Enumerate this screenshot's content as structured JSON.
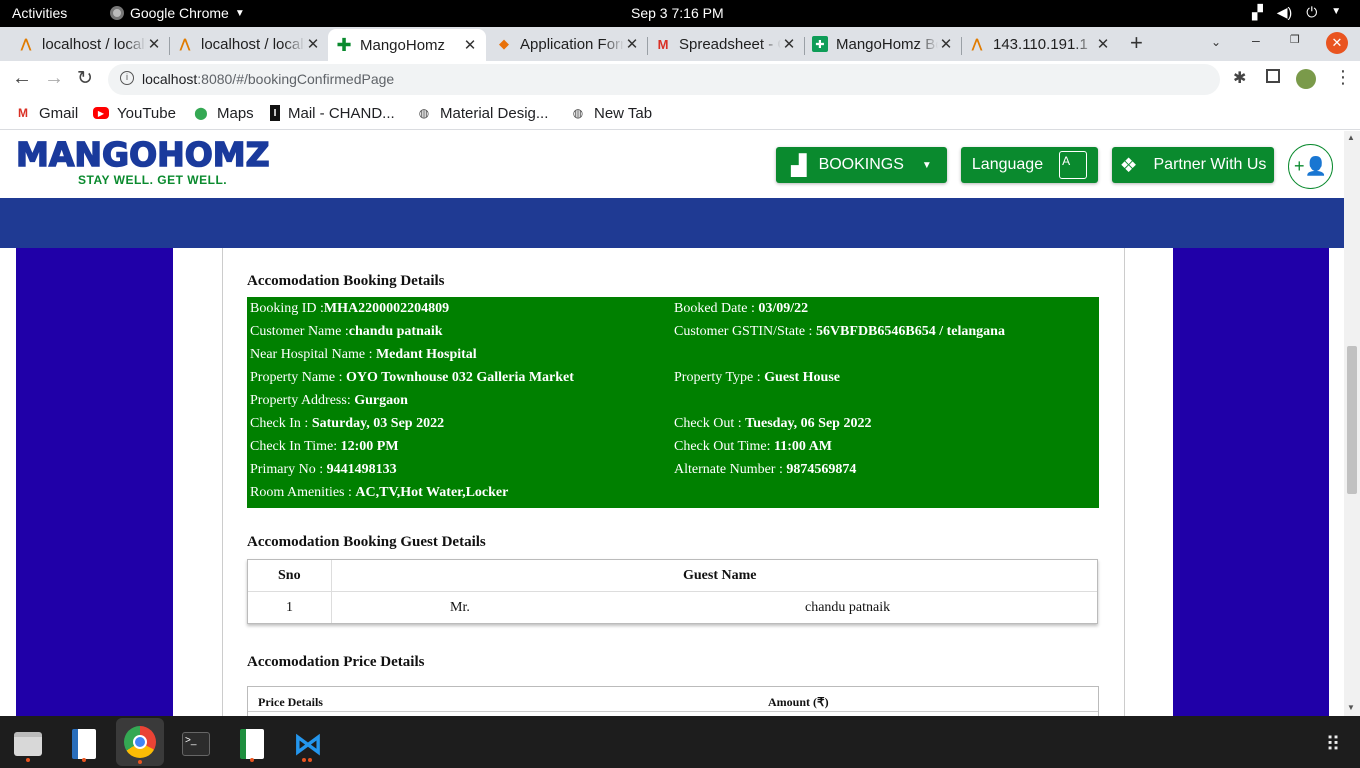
{
  "topbar": {
    "activities": "Activities",
    "app_name": "Google Chrome",
    "datetime": "Sep 3  7:16 PM"
  },
  "tabs": [
    {
      "title": "localhost / localhost"
    },
    {
      "title": "localhost / localhost"
    },
    {
      "title": "MangoHomz"
    },
    {
      "title": "Application Form"
    },
    {
      "title": "Spreadsheet - Gmail"
    },
    {
      "title": "MangoHomz Booking"
    },
    {
      "title": "143.110.191.1"
    }
  ],
  "omnibox": {
    "host": "localhost",
    "path": ":8080/#/bookingConfirmedPage"
  },
  "bookmarks": [
    "Gmail",
    "YouTube",
    "Maps",
    "Mail - CHAND...",
    "Material Desig...",
    "New Tab"
  ],
  "brand": {
    "logo_text": "MANGOHOMZ",
    "tagline": "STAY WELL. GET WELL."
  },
  "nav": {
    "bookings": "BOOKINGS",
    "language": "Language",
    "partner": "Partner With Us"
  },
  "booking_details": {
    "heading": "Accomodation Booking Details",
    "booking_id_label": "Booking ID :",
    "booking_id": "MHA2200002204809",
    "booked_date_label": "Booked Date : ",
    "booked_date": "03/09/22",
    "customer_name_label": "Customer Name :",
    "customer_name": "chandu patnaik",
    "gstin_label": "Customer GSTIN/State : ",
    "gstin": "56VBFDB6546B654 / telangana",
    "hospital_label": "Near Hospital Name : ",
    "hospital": "Medant Hospital",
    "property_name_label": "Property Name : ",
    "property_name": "OYO Townhouse 032 Galleria Market",
    "property_type_label": "Property Type : ",
    "property_type": "Guest House",
    "address_label": "Property Address: ",
    "address": "Gurgaon",
    "checkin_label": "Check In : ",
    "checkin": "Saturday, 03 Sep 2022",
    "checkout_label": "Check Out : ",
    "checkout": "Tuesday, 06 Sep 2022",
    "checkin_time_label": "Check In Time: ",
    "checkin_time": "12:00 PM",
    "checkout_time_label": "Check Out Time: ",
    "checkout_time": "11:00 AM",
    "primary_label": "Primary No : ",
    "primary": "9441498133",
    "alternate_label": "Alternate Number : ",
    "alternate": "9874569874",
    "amenities_label": "Room Amenities : ",
    "amenities": "AC,TV,Hot Water,Locker"
  },
  "guest_details": {
    "heading": "Accomodation Booking Guest Details",
    "columns": [
      "Sno",
      "Guest Name"
    ],
    "rows": [
      {
        "sno": "1",
        "title": "Mr.",
        "name": "chandu patnaik"
      }
    ]
  },
  "price_details": {
    "heading": "Accomodation Price Details",
    "columns": [
      "Price Details",
      "Amount (₹)"
    ]
  },
  "colors": {
    "brand_blue": "#1a3a9c",
    "brand_green": "#0a8a2e",
    "detail_green": "#008000",
    "side_purple": "#2000a8"
  }
}
